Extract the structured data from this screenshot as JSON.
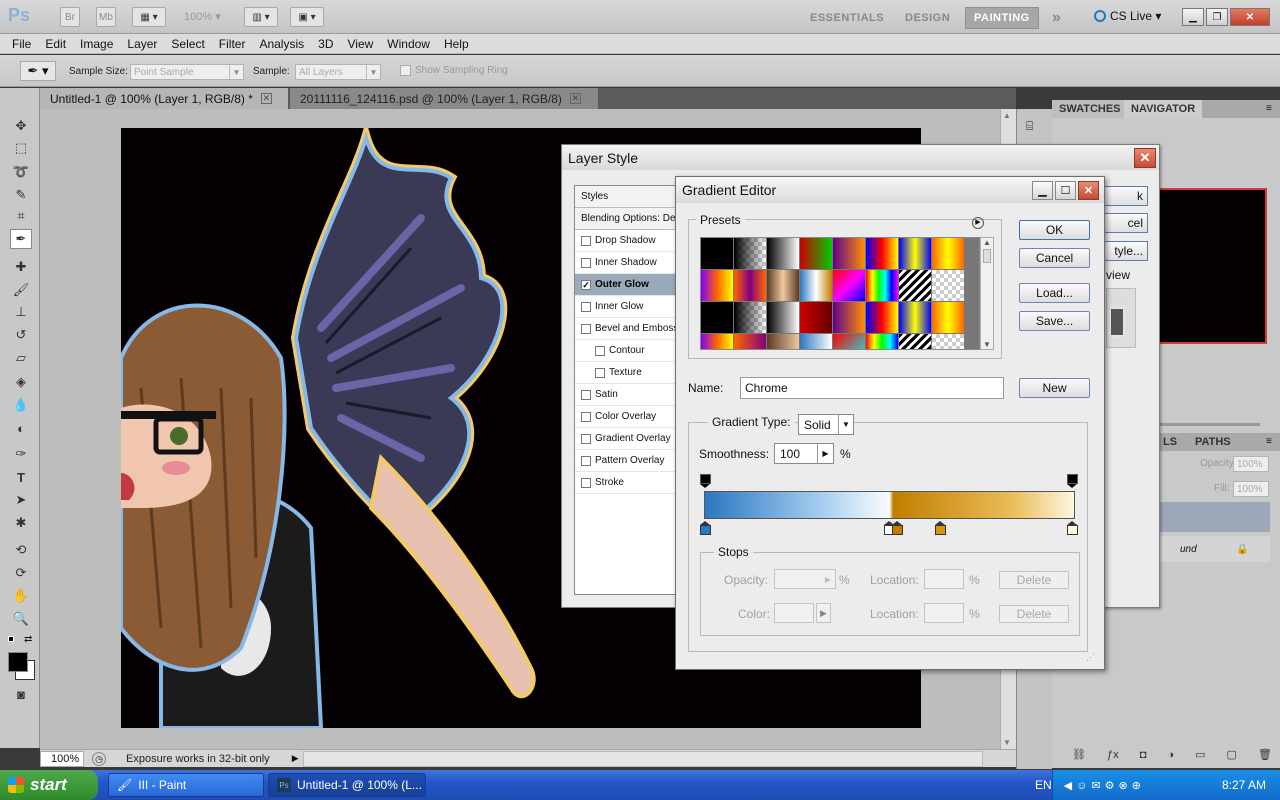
{
  "app": {
    "logo": "Ps",
    "bridge_btn": "Br",
    "minibridge_btn": "Mb",
    "zoom": "100%",
    "workspaces": [
      "ESSENTIALS",
      "DESIGN",
      "PAINTING"
    ],
    "more": "»",
    "cs_live": "CS Live"
  },
  "menu": [
    "File",
    "Edit",
    "Image",
    "Layer",
    "Select",
    "Filter",
    "Analysis",
    "3D",
    "View",
    "Window",
    "Help"
  ],
  "options": {
    "sample_size_label": "Sample Size:",
    "sample_size_value": "Point Sample",
    "sample_label": "Sample:",
    "sample_value": "All Layers",
    "show_ring": "Show Sampling Ring"
  },
  "doc_tabs": [
    {
      "label": "Untitled-1 @ 100% (Layer 1, RGB/8) *"
    },
    {
      "label": "20111116_124116.psd @ 100% (Layer 1, RGB/8)"
    }
  ],
  "status": {
    "zoom": "100%",
    "message": "Exposure works in 32-bit only"
  },
  "right_panels": {
    "top_tabs": [
      "SWATCHES",
      "NAVIGATOR"
    ],
    "layer_tabs": [
      "LS",
      "PATHS"
    ],
    "opacity_label": "Opacity:",
    "opacity_value": "100%",
    "fill_label": "Fill:",
    "fill_value": "100%",
    "layer_name": "und"
  },
  "layer_style": {
    "title": "Layer Style",
    "close": "✕",
    "items": [
      {
        "label": "Styles",
        "checkbox": false,
        "header": true
      },
      {
        "label": "Blending Options: Def",
        "checkbox": false,
        "header": true
      },
      {
        "label": "Drop Shadow",
        "checkbox": true,
        "checked": false
      },
      {
        "label": "Inner Shadow",
        "checkbox": true,
        "checked": false
      },
      {
        "label": "Outer Glow",
        "checkbox": true,
        "checked": true
      },
      {
        "label": "Inner Glow",
        "checkbox": true,
        "checked": false
      },
      {
        "label": "Bevel and Emboss",
        "checkbox": true,
        "checked": false
      },
      {
        "label": "Contour",
        "checkbox": true,
        "checked": false,
        "indent": true
      },
      {
        "label": "Texture",
        "checkbox": true,
        "checked": false,
        "indent": true
      },
      {
        "label": "Satin",
        "checkbox": true,
        "checked": false
      },
      {
        "label": "Color Overlay",
        "checkbox": true,
        "checked": false
      },
      {
        "label": "Gradient Overlay",
        "checkbox": true,
        "checked": false
      },
      {
        "label": "Pattern Overlay",
        "checkbox": true,
        "checked": false
      },
      {
        "label": "Stroke",
        "checkbox": true,
        "checked": false
      }
    ],
    "right_buttons": [
      "k",
      "cel",
      "tyle..."
    ],
    "preview_label": "view"
  },
  "gradient_editor": {
    "title": "Gradient Editor",
    "presets_label": "Presets",
    "ok": "OK",
    "cancel": "Cancel",
    "load": "Load...",
    "save": "Save...",
    "name_label": "Name:",
    "name_value": "Chrome",
    "new": "New",
    "type_label": "Gradient Type:",
    "type_value": "Solid",
    "smooth_label": "Smoothness:",
    "smooth_value": "100",
    "percent": "%",
    "stops_label": "Stops",
    "opacity_label": "Opacity:",
    "color_label": "Color:",
    "location_label": "Location:",
    "delete": "Delete",
    "colors": {
      "stop_a": "#2b77c0",
      "stop_b": "#c07e00",
      "stop_c": "#fdf6e0"
    }
  },
  "taskbar": {
    "start": "start",
    "tasks": [
      "III - Paint",
      "Untitled-1 @ 100% (L..."
    ],
    "lang": "EN",
    "time": "8:27 AM"
  }
}
